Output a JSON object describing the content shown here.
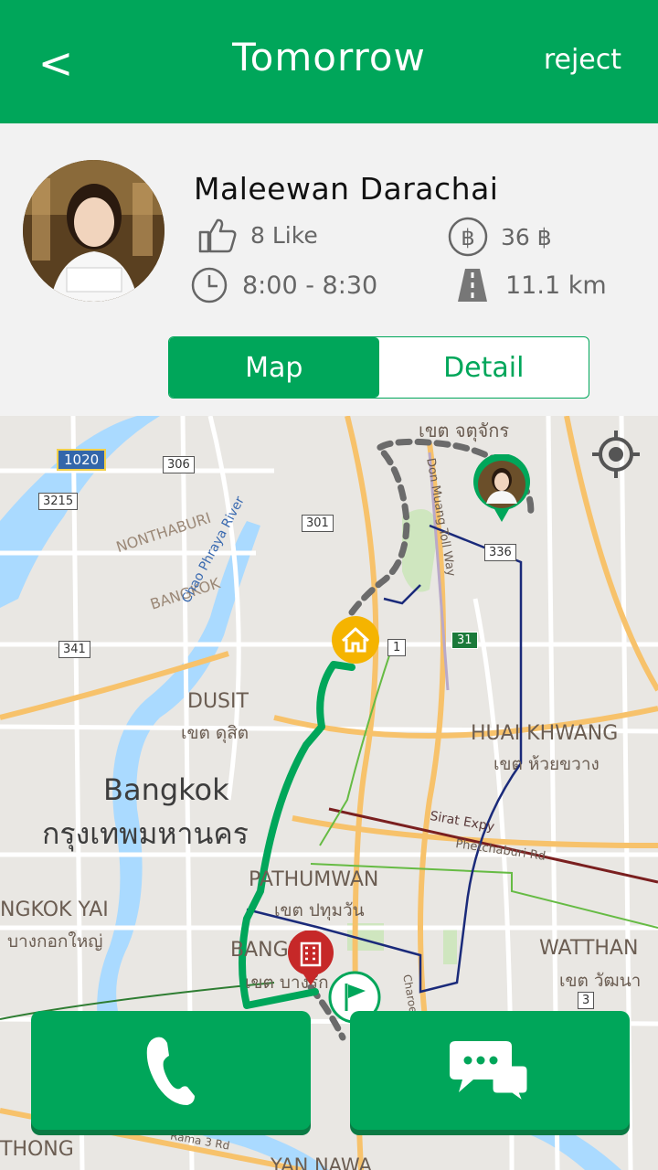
{
  "header": {
    "back_label": "<",
    "title": "Tomorrow",
    "reject_label": "reject"
  },
  "driver": {
    "name": "Maleewan Darachai",
    "likes": "8 Like",
    "price": "36 ฿",
    "time": "8:00 - 8:30",
    "distance": "11.1 km"
  },
  "tabs": {
    "map_label": "Map",
    "detail_label": "Detail",
    "active": "Map"
  },
  "map": {
    "labels": {
      "chatuchak": "เขต จตุจักร",
      "nonthaburi": "NONTHABURI",
      "bangkok_small": "BANGKOK",
      "chao_phraya": "Chao Phraya River",
      "don_mueang": "Don Muang Toll Way",
      "dusit": "DUSIT",
      "dusit_th": "เขต ดุสิต",
      "huai_khwang": "HUAI KHWANG",
      "huai_khwang_th": "เขต ห้วยขวาง",
      "bangkok": "Bangkok",
      "bangkok_th": "กรุงเทพมหานคร",
      "sirat": "Sirat Expy",
      "phetchaburi": "Phetchaburi Rd",
      "pathumwan": "PATHUMWAN",
      "pathumwan_th": "เขต ปทุมวัน",
      "bangkok_yai": "NGKOK YAI",
      "bangkok_yai_th": "บางกอกใหญ่",
      "bangrak": "BANGRAK",
      "bangrak_th": "เขต บางรัก",
      "watthana": "WATTHAN",
      "watthana_th": "เขต วัฒนา",
      "thong": "THONG",
      "yan_nawa": "YAN NAWA",
      "rama3": "Rama 3 Rd",
      "charoen": "Charoen"
    },
    "route_shields": [
      "1020",
      "306",
      "3215",
      "301",
      "336",
      "341",
      "1",
      "31",
      "3"
    ]
  },
  "actions": {
    "call_icon": "phone-icon",
    "chat_icon": "chat-bubbles-icon"
  },
  "colors": {
    "brand": "#00a65a",
    "home_pin": "#f5b400",
    "work_pin": "#c62828"
  }
}
